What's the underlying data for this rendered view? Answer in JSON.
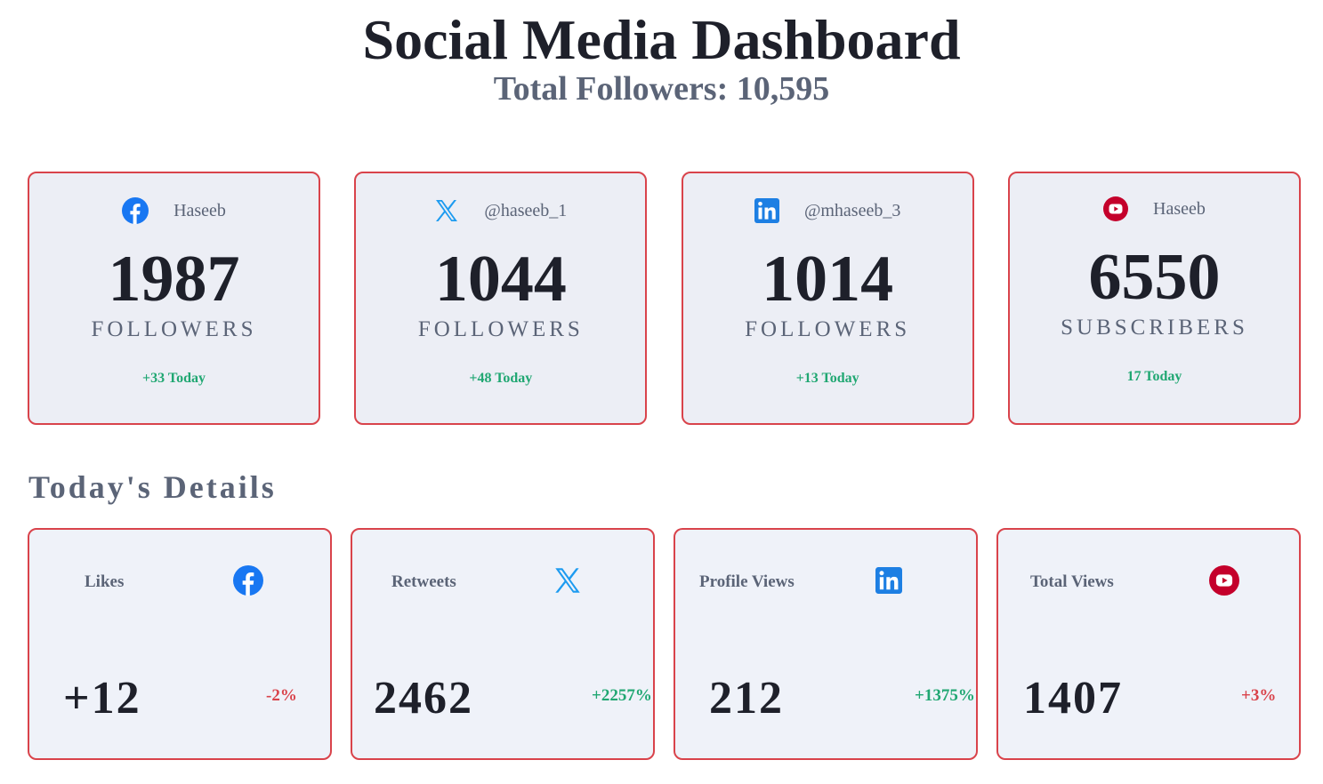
{
  "header": {
    "title": "Social Media Dashboard",
    "total_followers": "Total Followers: 10,595"
  },
  "colors": {
    "card_border": "#d9434b",
    "card_bg": "#eceef5",
    "positive": "#20a772",
    "negative": "#d9434b",
    "facebook": "#1877f2",
    "twitter": "#1d9bf0",
    "linkedin": "#0a66c2",
    "youtube": "#c4002b"
  },
  "platforms": [
    {
      "icon": "facebook-icon",
      "handle": "Haseeb",
      "count": "1987",
      "unit": "FOLLOWERS",
      "today": "+33 Today"
    },
    {
      "icon": "x-twitter-icon",
      "handle": "@haseeb_1",
      "count": "1044",
      "unit": "FOLLOWERS",
      "today": "+48 Today"
    },
    {
      "icon": "linkedin-icon",
      "handle": "@mhaseeb_3",
      "count": "1014",
      "unit": "FOLLOWERS",
      "today": "+13 Today"
    },
    {
      "icon": "youtube-icon",
      "handle": "Haseeb",
      "count": "6550",
      "unit": "SUBSCRIBERS",
      "today": "17 Today"
    }
  ],
  "details": {
    "title": "Today's Details",
    "items": [
      {
        "label": "Likes",
        "icon": "facebook-icon",
        "value": "+12",
        "percent": "-2%",
        "trend": "down"
      },
      {
        "label": "Retweets",
        "icon": "x-twitter-icon",
        "value": "2462",
        "percent": "+2257%",
        "trend": "up"
      },
      {
        "label": "Profile Views",
        "icon": "linkedin-icon",
        "value": "212",
        "percent": "+1375%",
        "trend": "up"
      },
      {
        "label": "Total Views",
        "icon": "youtube-icon",
        "value": "1407",
        "percent": "+3%",
        "trend": "down"
      }
    ]
  }
}
